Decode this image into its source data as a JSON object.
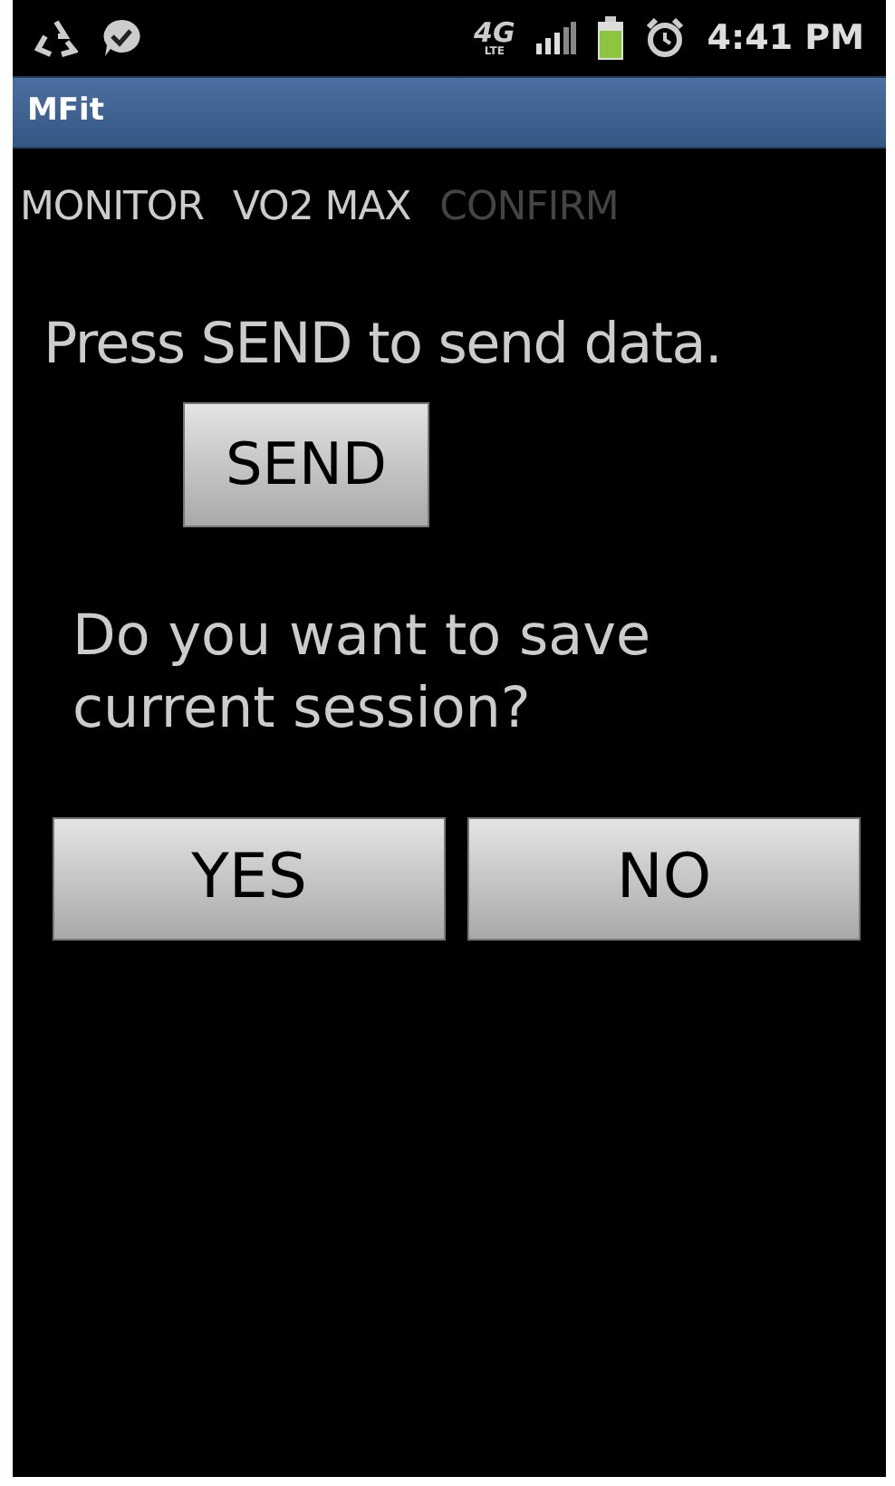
{
  "status_bar": {
    "network": "4G",
    "network_sub": "LTE",
    "time": "4:41 PM"
  },
  "window": {
    "title": "MFit"
  },
  "tabs": [
    {
      "label": "MONITOR",
      "disabled": false
    },
    {
      "label": "VO2 MAX",
      "disabled": false
    },
    {
      "label": "CONFIRM",
      "disabled": true
    }
  ],
  "send_prompt": "Press SEND to send data.",
  "send_button": "SEND",
  "save_question": "Do you want to save current session?",
  "buttons": [
    "YES",
    "NO"
  ]
}
